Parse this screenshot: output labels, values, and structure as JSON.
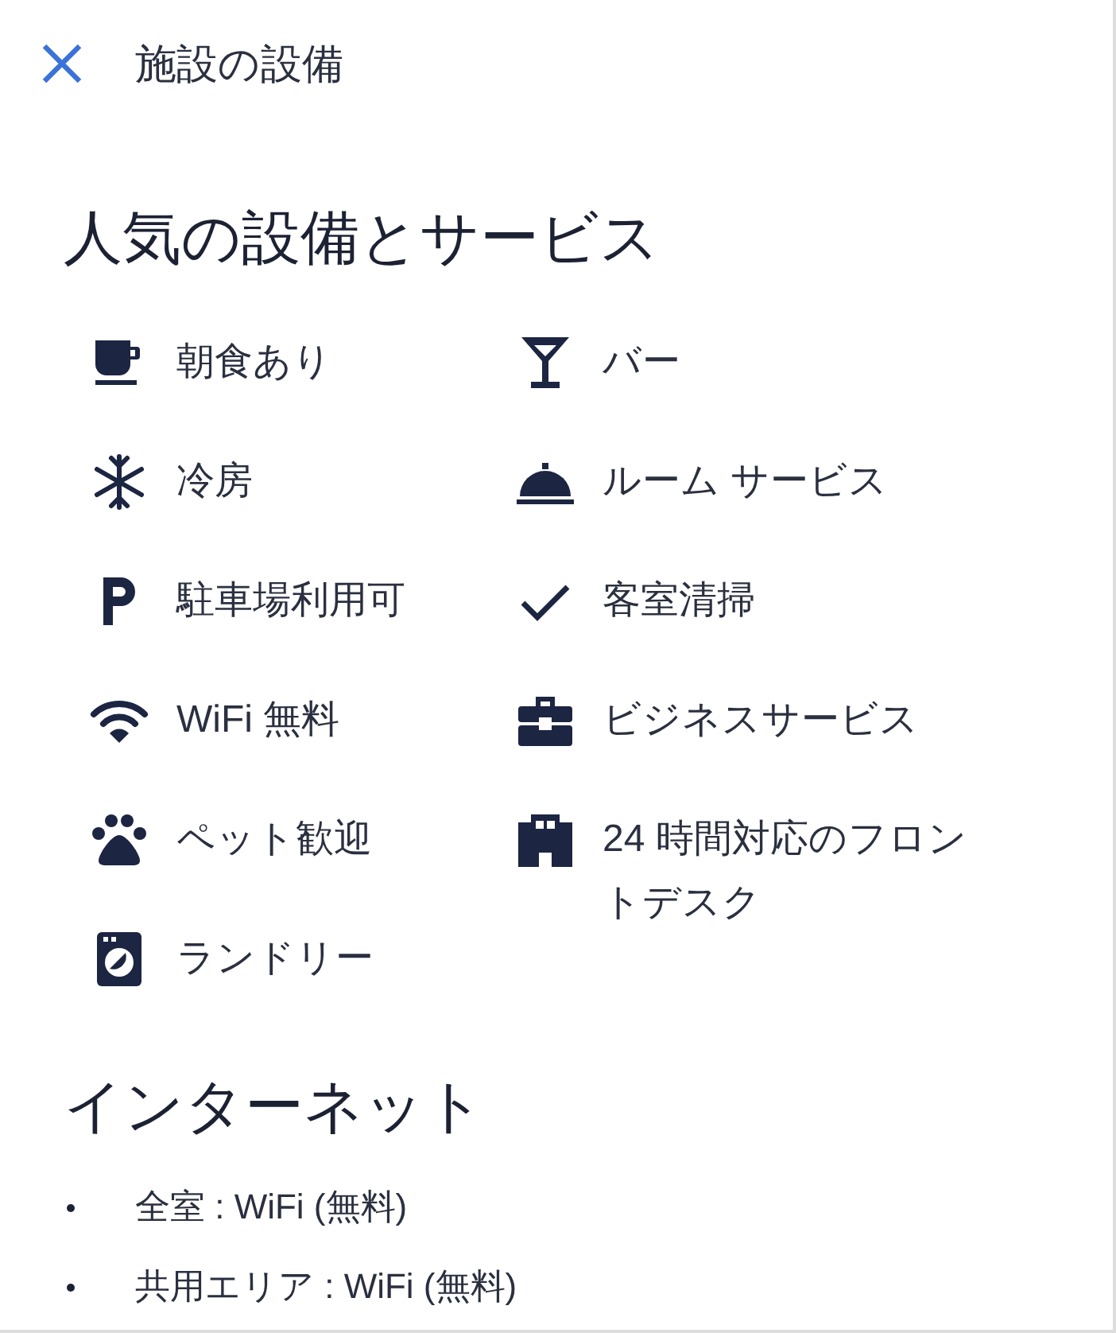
{
  "header": {
    "title": "施設の設備"
  },
  "popular": {
    "heading": "人気の設備とサービス",
    "left": [
      {
        "kind": "cup",
        "label": "朝食あり"
      },
      {
        "kind": "snowflake",
        "label": "冷房"
      },
      {
        "kind": "parking",
        "label": "駐車場利用可"
      },
      {
        "kind": "wifi",
        "label": "WiFi 無料"
      },
      {
        "kind": "paw",
        "label": "ペット歓迎"
      },
      {
        "kind": "washer",
        "label": "ランドリー"
      }
    ],
    "right": [
      {
        "kind": "cocktail",
        "label": "バー"
      },
      {
        "kind": "cloche",
        "label": "ルーム サービス"
      },
      {
        "kind": "check",
        "label": "客室清掃"
      },
      {
        "kind": "briefcase",
        "label": "ビジネスサービス"
      },
      {
        "kind": "building",
        "label": "24 時間対応のフロントデスク"
      }
    ]
  },
  "internet": {
    "heading": "インターネット",
    "items": [
      "全室 : WiFi (無料)",
      "共用エリア : WiFi (無料)"
    ]
  }
}
